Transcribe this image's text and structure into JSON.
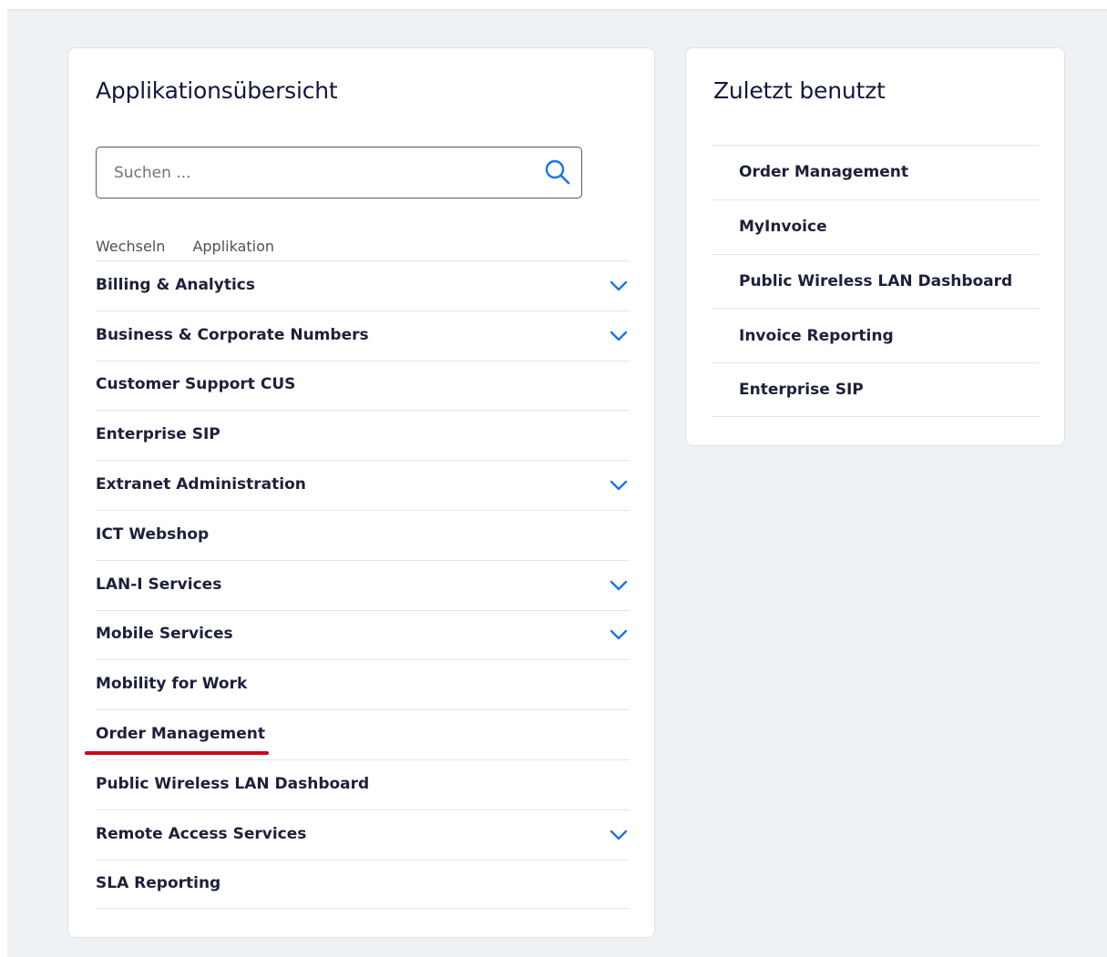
{
  "apps_card": {
    "title": "Applikationsübersicht",
    "search": {
      "placeholder": "Suchen ...",
      "value": ""
    },
    "columns": [
      "Wechseln",
      "Applikation"
    ],
    "items": [
      {
        "label": "Billing & Analytics",
        "expandable": true
      },
      {
        "label": "Business & Corporate Numbers",
        "expandable": true
      },
      {
        "label": "Customer Support CUS",
        "expandable": false
      },
      {
        "label": "Enterprise SIP",
        "expandable": false
      },
      {
        "label": "Extranet Administration",
        "expandable": true
      },
      {
        "label": "ICT Webshop",
        "expandable": false
      },
      {
        "label": "LAN-I Services",
        "expandable": true
      },
      {
        "label": "Mobile Services",
        "expandable": true
      },
      {
        "label": "Mobility for Work",
        "expandable": false
      },
      {
        "label": "Order Management",
        "expandable": false,
        "annotated": true
      },
      {
        "label": "Public Wireless LAN Dashboard",
        "expandable": false
      },
      {
        "label": "Remote Access Services",
        "expandable": true
      },
      {
        "label": "SLA Reporting",
        "expandable": false
      }
    ]
  },
  "recent_card": {
    "title": "Zuletzt benutzt",
    "items": [
      "Order Management",
      "MyInvoice",
      "Public Wireless LAN Dashboard",
      "Invoice Reporting",
      "Enterprise SIP"
    ]
  },
  "colors": {
    "accent": "#1a73e8",
    "annotation": "#d0021b",
    "background": "#eef2f5",
    "text": "#1d2039"
  }
}
